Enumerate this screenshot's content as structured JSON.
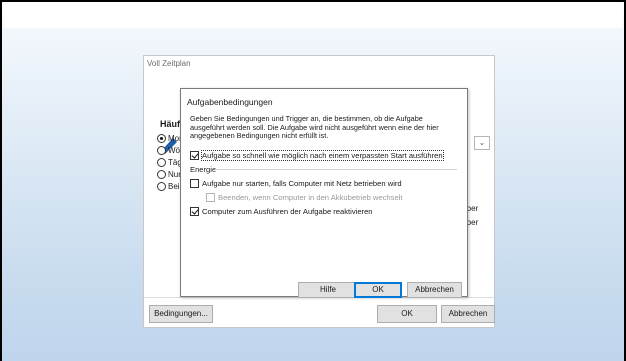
{
  "background_window": {
    "title": "Voll Zeitplan",
    "heading": "Häufi",
    "radios": [
      {
        "label": "Mor",
        "checked": true
      },
      {
        "label": "Wöc",
        "checked": false
      },
      {
        "label": "Täg",
        "checked": false
      },
      {
        "label": "Nur",
        "checked": false
      },
      {
        "label": "Beir",
        "checked": false
      }
    ],
    "combo_arrow": "⌄",
    "right_texts": [
      "mber",
      "mber"
    ],
    "conditions_button": "Bedingungen...",
    "ok_button": "OK",
    "cancel_button": "Abbrechen"
  },
  "dialog": {
    "title": "Aufgabenbedingungen",
    "description": "Geben Sie Bedingungen und Trigger an, die bestimmen, ob die Aufgabe ausgeführt werden soll. Die Aufgabe wird nicht ausgeführt wenn eine der hier angegebenen Bedingungen nicht erfüllt ist.",
    "checkbox_missed_start": {
      "label": "Aufgabe so schnell wie möglich nach einem verpassten Start ausführen",
      "checked": true
    },
    "energy_group_label": "Energie",
    "checkbox_ac_power": {
      "label": "Aufgabe nur starten, falls Computer mit Netz betrieben wird",
      "checked": false
    },
    "checkbox_battery_stop": {
      "label": "Beenden, wenn Computer in den Akkubetrieb wechselt",
      "checked": false,
      "disabled": true
    },
    "checkbox_wake": {
      "label": "Computer zum Ausführen der Aufgabe reaktivieren",
      "checked": true
    },
    "help_button": "Hilfe",
    "ok_button": "OK",
    "cancel_button": "Abbrechen"
  },
  "colors": {
    "accent": "#0078d7",
    "pencil": "#1e5fa8"
  }
}
